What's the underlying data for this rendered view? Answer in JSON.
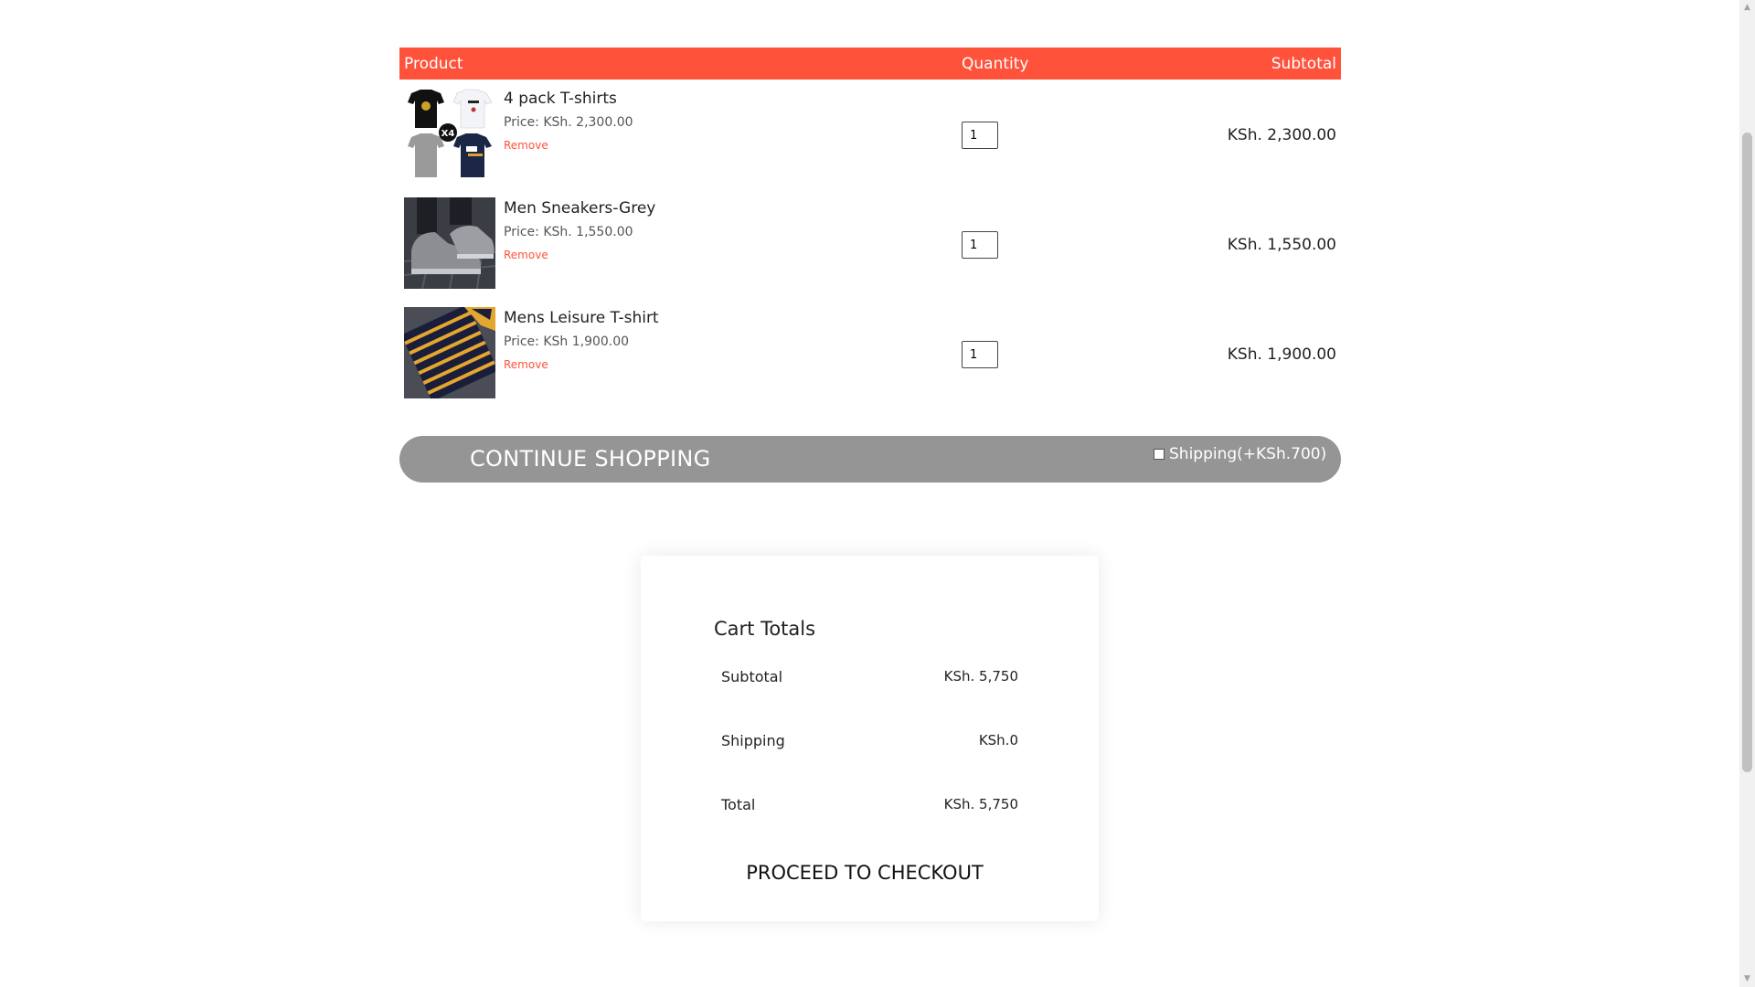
{
  "cart": {
    "headers": {
      "product": "Product",
      "quantity": "Quantity",
      "subtotal": "Subtotal"
    },
    "remove_label": "Remove",
    "items": [
      {
        "name": "4 pack T-shirts",
        "price": "Price: KSh. 2,300.00",
        "quantity": "1",
        "subtotal": "KSh. 2,300.00",
        "image_icon": "tshirt-pack-image",
        "image_badge": "X4"
      },
      {
        "name": "Men Sneakers-Grey",
        "price": "Price: KSh. 1,550.00",
        "quantity": "1",
        "subtotal": "KSh. 1,550.00",
        "image_icon": "sneaker-image"
      },
      {
        "name": "Mens Leisure T-shirt",
        "price": "Price: KSh 1,900.00",
        "quantity": "1",
        "subtotal": "KSh. 1,900.00",
        "image_icon": "striped-polo-image"
      }
    ]
  },
  "actions": {
    "continue_label": "CONTINUE SHOPPING",
    "shipping_option_label": "Shipping(+KSh.700)",
    "shipping_checked": false
  },
  "totals": {
    "title": "Cart Totals",
    "rows": [
      {
        "label": "Subtotal",
        "value": "KSh. 5,750"
      },
      {
        "label": "Shipping",
        "value": "KSh.0"
      },
      {
        "label": "Total",
        "value": "KSh. 5,750"
      }
    ],
    "checkout_label": "PROCEED TO CHECKOUT"
  },
  "colors": {
    "accent": "#ff523b",
    "bar": "#959595"
  }
}
